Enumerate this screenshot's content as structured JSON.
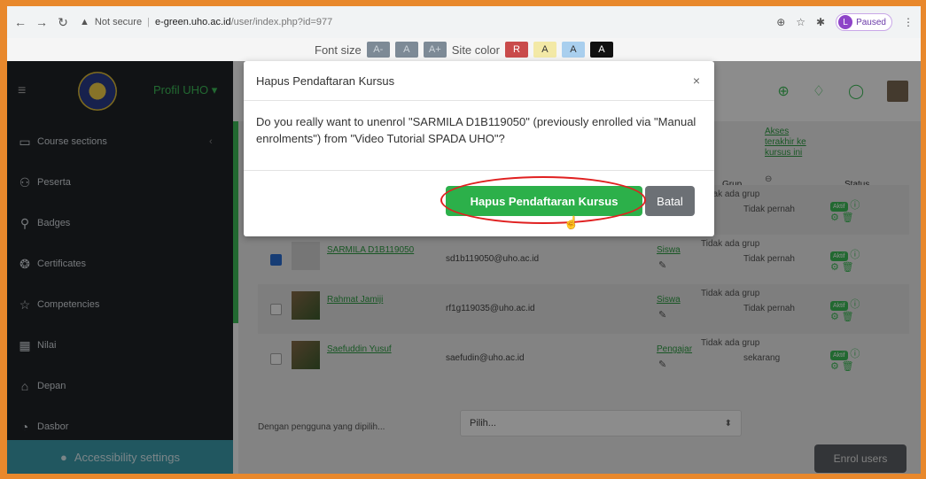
{
  "browser": {
    "security": "Not secure",
    "host": "e-green.uho.ac.id",
    "path": "/user/index.php?id=977",
    "profile_initial": "L",
    "paused_label": "Paused"
  },
  "fontbar": {
    "font_size_label": "Font size",
    "font_chips": [
      "A-",
      "A",
      "A+"
    ],
    "site_color_label": "Site color",
    "color_chips": [
      "R",
      "A",
      "A",
      "A"
    ]
  },
  "sidebar": {
    "profil_label": "Profil UHO",
    "items": [
      {
        "label": "Course sections",
        "icon": "folder-icon"
      },
      {
        "label": "Peserta",
        "icon": "users-icon"
      },
      {
        "label": "Badges",
        "icon": "badges-icon"
      },
      {
        "label": "Certificates",
        "icon": "certificate-icon"
      },
      {
        "label": "Competencies",
        "icon": "star-icon"
      },
      {
        "label": "Nilai",
        "icon": "grades-icon"
      },
      {
        "label": "Depan",
        "icon": "home-icon"
      },
      {
        "label": "Dasbor",
        "icon": "dashboard-icon"
      }
    ],
    "accessibility_label": "Accessibility settings"
  },
  "table": {
    "headers": {
      "grup": "Grup",
      "akses": "Akses terakhir ke kursus ini",
      "status": "Status"
    },
    "rows": [
      {
        "name": "",
        "email": "",
        "role": "",
        "grup": "Tidak ada grup",
        "akses": "Tidak pernah",
        "status": "Aktif",
        "checked": false,
        "photo": false
      },
      {
        "name": "SARMILA D1B119050",
        "email": "sd1b119050@uho.ac.id",
        "role": "Siswa",
        "grup": "Tidak ada grup",
        "akses": "Tidak pernah",
        "status": "Aktif",
        "checked": true,
        "photo": false
      },
      {
        "name": "Rahmat Jamiji",
        "email": "rf1g119035@uho.ac.id",
        "role": "Siswa",
        "grup": "Tidak ada grup",
        "akses": "Tidak pernah",
        "status": "Aktif",
        "checked": false,
        "photo": true
      },
      {
        "name": "Saefuddin Yusuf",
        "email": "saefudin@uho.ac.id",
        "role": "Pengajar",
        "grup": "Tidak ada grup",
        "akses": "sekarang",
        "status": "Aktif",
        "checked": false,
        "photo": true
      }
    ]
  },
  "bulk": {
    "with_selected_label": "Dengan pengguna yang dipilih...",
    "select_value": "Pilih..."
  },
  "enrol_label": "Enrol users",
  "modal": {
    "title": "Hapus Pendaftaran Kursus",
    "close": "×",
    "message": "Do you really want to unenrol \"SARMILA D1B119050\" (previously enrolled via \"Manual enrolments\") from \"Video Tutorial SPADA UHO\"?",
    "confirm_label": "Hapus Pendaftaran Kursus",
    "cancel_label": "Batal"
  },
  "colors": {
    "accent": "#2cb04a",
    "sidebar_bg": "#1f2327",
    "frame": "#e8882c"
  }
}
